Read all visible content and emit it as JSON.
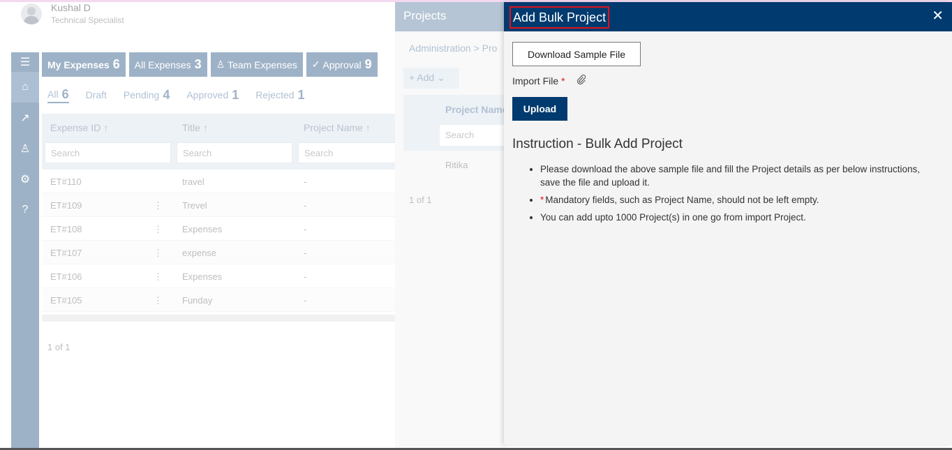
{
  "user": {
    "name": "Kushal D",
    "role": "Technical Specialist"
  },
  "tabs": [
    {
      "label": "My Expenses",
      "count": "6"
    },
    {
      "label": "All Expenses",
      "count": "3"
    },
    {
      "label": "Team Expenses",
      "count": ""
    },
    {
      "label": "Approval",
      "count": "9"
    }
  ],
  "subtabs": [
    {
      "label": "All",
      "count": "6"
    },
    {
      "label": "Draft",
      "count": ""
    },
    {
      "label": "Pending",
      "count": "4"
    },
    {
      "label": "Approved",
      "count": "1"
    },
    {
      "label": "Rejected",
      "count": "1"
    }
  ],
  "grid": {
    "columns": [
      "Expense ID ↑",
      "Title ↑",
      "Project Name ↑"
    ],
    "search_placeholder": "Search",
    "rows": [
      {
        "id": "ET#110",
        "title": "travel",
        "project": "-"
      },
      {
        "id": "ET#109",
        "title": "Trevel",
        "project": "-"
      },
      {
        "id": "ET#108",
        "title": "Expenses",
        "project": "-"
      },
      {
        "id": "ET#107",
        "title": "expense",
        "project": "-"
      },
      {
        "id": "ET#106",
        "title": "Expenses",
        "project": "-"
      },
      {
        "id": "ET#105",
        "title": "Funday",
        "project": "-"
      }
    ],
    "pager": "1 of 1"
  },
  "projects": {
    "title": "Projects",
    "breadcrumb": "Administration  >  Pro",
    "add_label": "Add",
    "column": "Project Name",
    "search_placeholder": "Search",
    "row": "Ritika",
    "pager": "1 of 1"
  },
  "dialog": {
    "title": "Add Bulk Project",
    "download_label": "Download Sample File",
    "import_label": "Import File",
    "required_mark": "*",
    "upload_label": "Upload",
    "instr_title": "Instruction - Bulk Add Project",
    "instructions": [
      "Please download the above sample file and fill the Project details as per below instructions, save the file and upload it.",
      "Mandatory fields, such as Project Name, should not be left empty.",
      "You can add upto 1000 Project(s) in one go from import Project."
    ]
  },
  "colors": {
    "primary": "#003a6e",
    "accent": "#e0131b",
    "rail": "#4f7399"
  }
}
